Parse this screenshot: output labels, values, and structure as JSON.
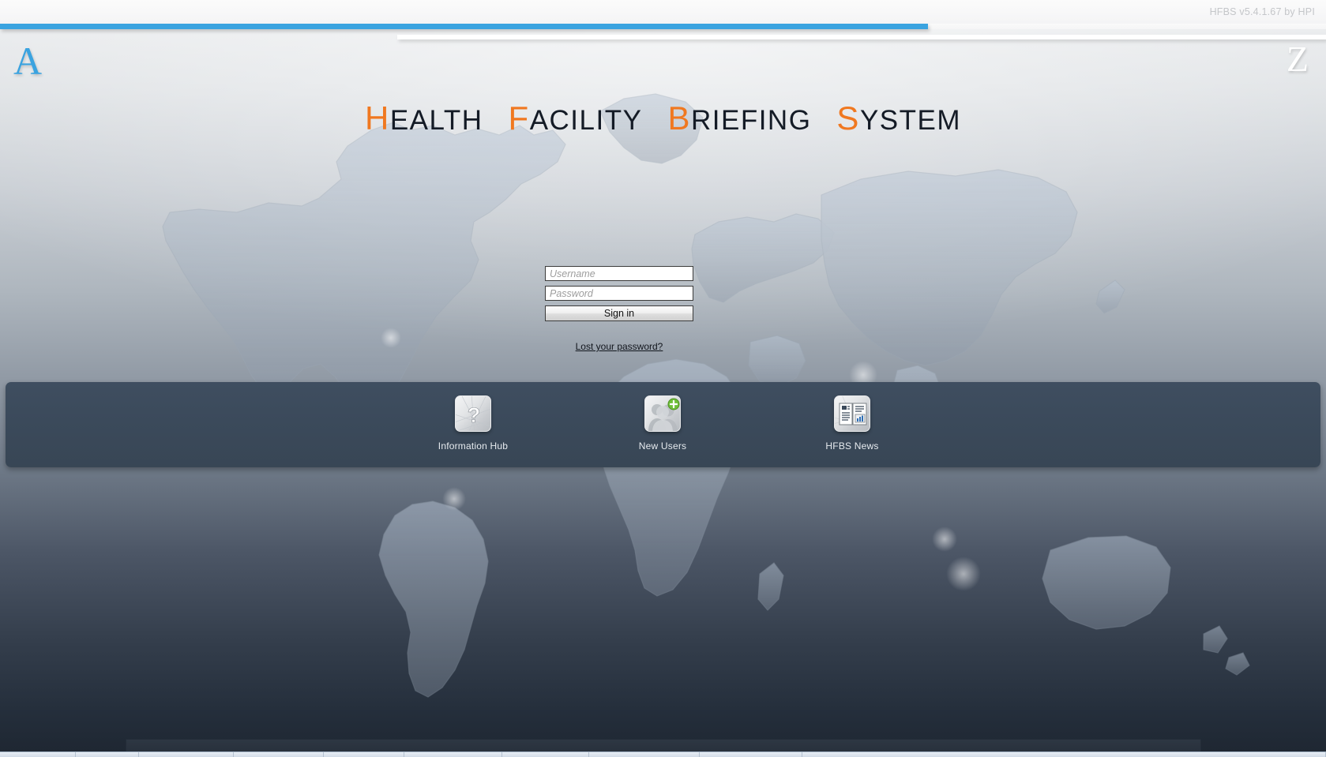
{
  "header": {
    "version_text": "HFBS v5.4.1.67 by HPI",
    "corner_left_letter": "A",
    "corner_right_letter": "Z",
    "accent_blue": "#3aa3e0"
  },
  "branding": {
    "accent_orange": "#f07820",
    "title_words": [
      {
        "lead": "H",
        "rest": "EALTH"
      },
      {
        "lead": "F",
        "rest": "ACILITY"
      },
      {
        "lead": "B",
        "rest": "RIEFING"
      },
      {
        "lead": "S",
        "rest": "YSTEM"
      }
    ]
  },
  "login": {
    "username_placeholder": "Username",
    "username_value": "",
    "password_placeholder": "Password",
    "password_value": "",
    "signin_label": "Sign in",
    "lost_password_label": "Lost your password?"
  },
  "action_band": {
    "background_color": "#3b4a5b",
    "items": [
      {
        "label": "Information Hub",
        "icon": "question-mark-icon"
      },
      {
        "label": "New Users",
        "icon": "user-add-icon"
      },
      {
        "label": "HFBS News",
        "icon": "newspaper-icon"
      }
    ]
  }
}
